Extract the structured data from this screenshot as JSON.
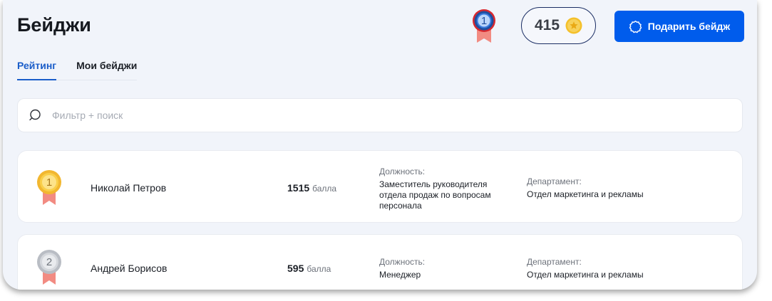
{
  "header": {
    "title": "Бейджи",
    "rank": "1",
    "points": "415",
    "gift_button_label": "Подарить бейдж"
  },
  "tabs": [
    {
      "label": "Рейтинг",
      "active": true
    },
    {
      "label": "Мои бейджи",
      "active": false
    }
  ],
  "search": {
    "placeholder": "Фильтр + поиск"
  },
  "rating": [
    {
      "rank": "1",
      "name": "Николай Петров",
      "score": "1515",
      "score_unit": "балла",
      "position_label": "Должность:",
      "position": "Заместитель руководителя отдела продаж по вопросам персонала",
      "department_label": "Департамент:",
      "department": "Отдел маркетинга и рекламы"
    },
    {
      "rank": "2",
      "name": "Андрей Борисов",
      "score": "595",
      "score_unit": "балла",
      "position_label": "Должность:",
      "position": "Менеджер",
      "department_label": "Департамент:",
      "department": "Отдел маркетинга и рекламы"
    }
  ],
  "icons": {
    "rank_medal": "medal-blue-icon",
    "coin": "coin-star-icon",
    "gift": "badge-outline-icon",
    "search": "search-icon",
    "gold_medal": "medal-gold-icon",
    "silver_medal": "medal-silver-icon"
  },
  "colors": {
    "accent": "#005cec",
    "tab_active": "#1a5dc9",
    "pill_border": "#1a2d63",
    "background": "#f1f4fa",
    "medal_ribbon": "#f28b82",
    "gold": "#f2b730",
    "silver": "#bfc3c9",
    "coin": "#f4c02a"
  }
}
